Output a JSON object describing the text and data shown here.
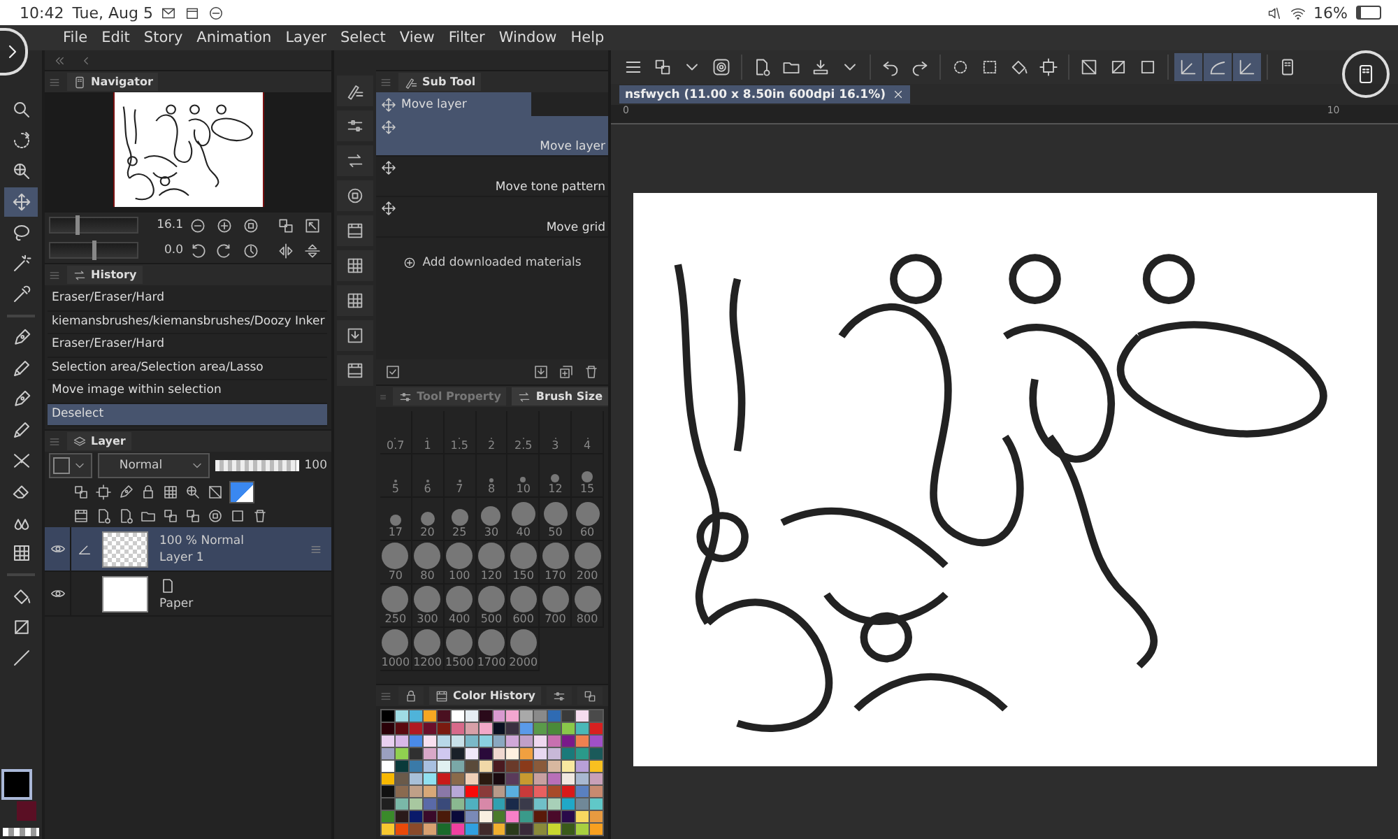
{
  "status_bar": {
    "time": "10:42",
    "date": "Tue, Aug 5",
    "battery": "16%"
  },
  "menu": [
    "File",
    "Edit",
    "Story",
    "Animation",
    "Layer",
    "Select",
    "View",
    "Filter",
    "Window",
    "Help"
  ],
  "tools": [
    {
      "selected": false
    },
    {
      "selected": false
    },
    {
      "selected": false
    },
    {
      "selected": true
    },
    {
      "selected": false
    },
    {
      "selected": false
    },
    {
      "selected": false
    },
    {
      "selected": false
    },
    {
      "selected": false
    },
    {
      "selected": false
    },
    {
      "selected": false
    },
    {
      "selected": false
    },
    {
      "selected": false
    },
    {
      "selected": false
    },
    {
      "selected": false
    },
    {
      "selected": false
    },
    {
      "selected": false
    },
    {
      "selected": false
    }
  ],
  "colors": [
    {
      "color": "#000000",
      "selected": true
    },
    {
      "color": "#5a0f24",
      "selected": false
    }
  ],
  "navigator": {
    "title": "Navigator",
    "zoom": {
      "value": "16.1",
      "level": 0.3
    },
    "rotation": {
      "value": "0.0",
      "level": 0.5
    }
  },
  "history": {
    "title": "History",
    "items": [
      {
        "label": "Eraser/Eraser/Hard",
        "selected": false
      },
      {
        "label": "kiemansbrushes/kiemansbrushes/Doozy Inker",
        "selected": false
      },
      {
        "label": "Eraser/Eraser/Hard",
        "selected": false
      },
      {
        "label": "Selection area/Selection area/Lasso",
        "selected": false
      },
      {
        "label": "Move image within selection",
        "selected": false
      },
      {
        "label": "Deselect",
        "selected": true
      }
    ]
  },
  "layer": {
    "title": "Layer",
    "blend_mode": "Normal",
    "opacity": {
      "value": "100",
      "level": 1
    },
    "layers": [
      {
        "kind": "raster",
        "info": "100 % Normal",
        "name": "Layer 1",
        "visible": true,
        "selected": true
      },
      {
        "kind": "paper",
        "name": "Paper",
        "visible": true,
        "selected": false
      }
    ]
  },
  "sub_tool": {
    "title": "Sub Tool",
    "group": "Move layer",
    "items": [
      {
        "label": "Move layer",
        "selected": true
      },
      {
        "label": "Move tone pattern",
        "selected": false
      },
      {
        "label": "Move grid",
        "selected": false
      }
    ],
    "add_label": "Add downloaded materials"
  },
  "brush_panel": {
    "tabs": [
      {
        "label": "Tool Property",
        "selected": false
      },
      {
        "label": "Brush Size",
        "selected": true
      }
    ],
    "sizes": [
      "0.7",
      "1",
      "1.5",
      "2",
      "2.5",
      "3",
      "4",
      "5",
      "6",
      "7",
      "8",
      "10",
      "12",
      "15",
      "17",
      "20",
      "25",
      "30",
      "40",
      "50",
      "60",
      "70",
      "80",
      "100",
      "120",
      "150",
      "170",
      "200",
      "250",
      "300",
      "400",
      "500",
      "600",
      "700",
      "800",
      "1000",
      "1200",
      "1500",
      "1700",
      "2000"
    ]
  },
  "color_history": {
    "title": "Color History",
    "swatches": [
      {
        "color": "#000000"
      },
      {
        "color": "#9fdce4"
      },
      {
        "color": "#4fb3d9"
      },
      {
        "color": "#f5a623"
      },
      {
        "color": "#4a1020"
      },
      {
        "color": "#ffffff"
      },
      {
        "color": "#e6edf2"
      },
      {
        "color": "#2a0a1a"
      },
      {
        "color": "#d99ad0"
      },
      {
        "color": "#f2a6cf"
      },
      {
        "color": "#a9a9a9"
      },
      {
        "color": "#8a8a8a"
      },
      {
        "color": "#2f6bb3"
      },
      {
        "color": "#3a3a3a"
      },
      {
        "color": "#f6dcef"
      },
      {
        "color": "#4a4a4a"
      },
      {
        "color": "#2a0008"
      },
      {
        "color": "#5a0a10"
      },
      {
        "color": "#b01a22"
      },
      {
        "color": "#6a0f2a"
      },
      {
        "color": "#7a1a10"
      },
      {
        "color": "#d86a8a"
      },
      {
        "color": "#d8a0a8"
      },
      {
        "color": "#f2a8c8"
      },
      {
        "color": "#0a1020"
      },
      {
        "color": "#3a3040"
      },
      {
        "color": "#5a9ae8"
      },
      {
        "color": "#5a9a4a"
      },
      {
        "color": "#4a8a3a"
      },
      {
        "color": "#8ac84a"
      },
      {
        "color": "#4ab8b8"
      },
      {
        "color": "#d82020"
      },
      {
        "color": "#e8d0f0"
      },
      {
        "color": "#d8b8e8"
      },
      {
        "color": "#4a8ae8"
      },
      {
        "color": "#f8e0f0"
      },
      {
        "color": "#b8d8e8"
      },
      {
        "color": "#c8e0e8"
      },
      {
        "color": "#7ab8c8"
      },
      {
        "color": "#8ad0e0"
      },
      {
        "color": "#8aa8c0"
      },
      {
        "color": "#d0a8d8"
      },
      {
        "color": "#c0a0c8"
      },
      {
        "color": "#f0d8f0"
      },
      {
        "color": "#c870b0"
      },
      {
        "color": "#7a1a8a"
      },
      {
        "color": "#f08050"
      },
      {
        "color": "#a050c8"
      },
      {
        "color": "#9aa0c0"
      },
      {
        "color": "#90d050"
      },
      {
        "color": "#303030"
      },
      {
        "color": "#d8a8c8"
      },
      {
        "color": "#d0c8f0"
      },
      {
        "color": "#1a2028"
      },
      {
        "color": "#f0e8f8"
      },
      {
        "color": "#2a0a3a"
      },
      {
        "color": "#f0d8d0"
      },
      {
        "color": "#fff0e0"
      },
      {
        "color": "#f0a040"
      },
      {
        "color": "#e8d8f0"
      },
      {
        "color": "#c8b8d8"
      },
      {
        "color": "#1a7a7a"
      },
      {
        "color": "#2a9a8a"
      },
      {
        "color": "#1a5a5a"
      },
      {
        "color": "#ffffff"
      },
      {
        "color": "#0a3a3a"
      },
      {
        "color": "#3a7aa8"
      },
      {
        "color": "#a8c0e0"
      },
      {
        "color": "#e0f0f0"
      },
      {
        "color": "#7aa8a8"
      },
      {
        "color": "#5a4a3a"
      },
      {
        "color": "#f0d8a8"
      },
      {
        "color": "#4a1a20"
      },
      {
        "color": "#6a3a2a"
      },
      {
        "color": "#8a3a1a"
      },
      {
        "color": "#8a5a3a"
      },
      {
        "color": "#d8b8a0"
      },
      {
        "color": "#f8e8a0"
      },
      {
        "color": "#b8a0d8"
      },
      {
        "color": "#f8c020"
      },
      {
        "color": "#f8b800"
      },
      {
        "color": "#6a5a4a"
      },
      {
        "color": "#a8c0d8"
      },
      {
        "color": "#90e0f0"
      },
      {
        "color": "#c81a1a"
      },
      {
        "color": "#8a6a4a"
      },
      {
        "color": "#f0d0b8"
      },
      {
        "color": "#2a1a10"
      },
      {
        "color": "#1a0a10"
      },
      {
        "color": "#5a3a5a"
      },
      {
        "color": "#c89a30"
      },
      {
        "color": "#c8a0a0"
      },
      {
        "color": "#b870b8"
      },
      {
        "color": "#f0e8e0"
      },
      {
        "color": "#a8b8d0"
      },
      {
        "color": "#c8a0b8"
      },
      {
        "color": "#101010"
      },
      {
        "color": "#8a6a50"
      },
      {
        "color": "#c0a088"
      },
      {
        "color": "#d8a878"
      },
      {
        "color": "#8a78a8"
      },
      {
        "color": "#b8a8d8"
      },
      {
        "color": "#f80a0a"
      },
      {
        "color": "#8a3a3a"
      },
      {
        "color": "#b89a8a"
      },
      {
        "color": "#5ab0e0"
      },
      {
        "color": "#c83a3a"
      },
      {
        "color": "#e86060"
      },
      {
        "color": "#a84a2a"
      },
      {
        "color": "#d81a1a"
      },
      {
        "color": "#5a80c0"
      },
      {
        "color": "#c88a70"
      },
      {
        "color": "#202020"
      },
      {
        "color": "#7ab8a8"
      },
      {
        "color": "#a8c8a0"
      },
      {
        "color": "#5a6aa8"
      },
      {
        "color": "#3a4a7a"
      },
      {
        "color": "#8ab890"
      },
      {
        "color": "#50b0c0"
      },
      {
        "color": "#d888a8"
      },
      {
        "color": "#30a0b0"
      },
      {
        "color": "#1a2a4a"
      },
      {
        "color": "#3a3a4a"
      },
      {
        "color": "#70c0c8"
      },
      {
        "color": "#a8d0b8"
      },
      {
        "color": "#20a8c8"
      },
      {
        "color": "#708898"
      },
      {
        "color": "#60c8c8"
      },
      {
        "color": "#3a8a2a"
      },
      {
        "color": "#2a1a1a"
      },
      {
        "color": "#0a1a6a"
      },
      {
        "color": "#3a0a2a"
      },
      {
        "color": "#4a1a0a"
      },
      {
        "color": "#0a0a3a"
      },
      {
        "color": "#7a8ab8"
      },
      {
        "color": "#f8f0e0"
      },
      {
        "color": "#4a7a2a"
      },
      {
        "color": "#f880c8"
      },
      {
        "color": "#3a9a8a"
      },
      {
        "color": "#5a1a0a"
      },
      {
        "color": "#4a0a2a"
      },
      {
        "color": "#2a0a4a"
      },
      {
        "color": "#f8d860"
      },
      {
        "color": "#e89a40"
      },
      {
        "color": "#f8c830"
      },
      {
        "color": "#e84a0a"
      },
      {
        "color": "#8a4a2a"
      },
      {
        "color": "#d8a070"
      },
      {
        "color": "#1a6a2a"
      },
      {
        "color": "#f040a0"
      },
      {
        "color": "#30a0e0"
      },
      {
        "color": "#402a2a"
      },
      {
        "color": "#f0b030"
      },
      {
        "color": "#2a3a1a"
      },
      {
        "color": "#3a2a3a"
      },
      {
        "color": "#8a8a3a"
      },
      {
        "color": "#c8d830"
      },
      {
        "color": "#3a5a1a"
      },
      {
        "color": "#a8d040"
      },
      {
        "color": "#f8a020"
      }
    ]
  },
  "document": {
    "tab": "nsfwych (11.00 x 8.50in 600dpi 16.1%)",
    "ruler": [
      "0",
      "10"
    ]
  }
}
